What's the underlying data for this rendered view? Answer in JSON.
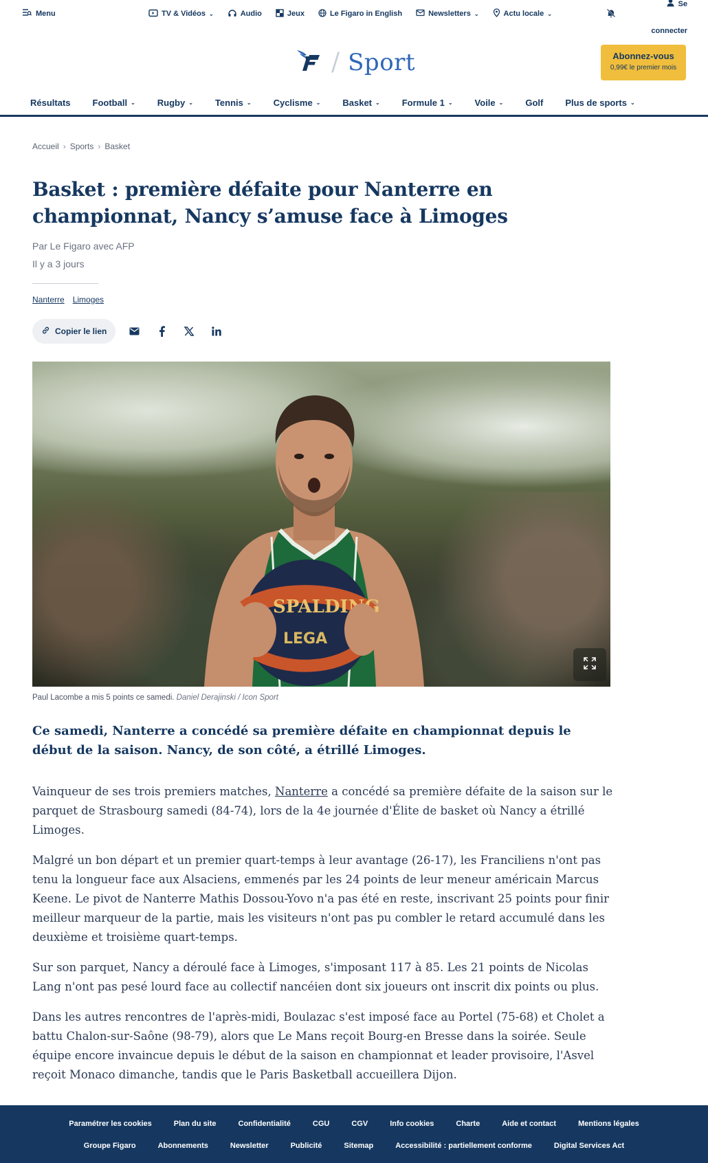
{
  "header": {
    "menu_label": "Menu",
    "top_links": [
      {
        "label": "TV & Vidéos",
        "icon": "tv-icon",
        "dropdown": true
      },
      {
        "label": "Audio",
        "icon": "headphones-icon",
        "dropdown": false
      },
      {
        "label": "Jeux",
        "icon": "grid-icon",
        "dropdown": false
      },
      {
        "label": "Le Figaro in English",
        "icon": "globe-icon",
        "dropdown": false
      },
      {
        "label": "Newsletters",
        "icon": "mail-icon",
        "dropdown": true
      },
      {
        "label": "Actu locale",
        "icon": "pin-icon",
        "dropdown": true
      }
    ],
    "login_line1": "Se",
    "login_line2": "connecter",
    "section_title": "Sport",
    "subscribe_title": "Abonnez-vous",
    "subscribe_offer": "0,99€ le premier mois"
  },
  "sport_nav": [
    {
      "label": "Résultats",
      "dropdown": false
    },
    {
      "label": "Football",
      "dropdown": true
    },
    {
      "label": "Rugby",
      "dropdown": true
    },
    {
      "label": "Tennis",
      "dropdown": true
    },
    {
      "label": "Cyclisme",
      "dropdown": true
    },
    {
      "label": "Basket",
      "dropdown": true
    },
    {
      "label": "Formule 1",
      "dropdown": true
    },
    {
      "label": "Voile",
      "dropdown": true
    },
    {
      "label": "Golf",
      "dropdown": false
    },
    {
      "label": "Plus de sports",
      "dropdown": true
    }
  ],
  "breadcrumb": [
    "Accueil",
    "Sports",
    "Basket"
  ],
  "article": {
    "title": "Basket : première défaite pour Nanterre en championnat, Nancy s’amuse face à Limoges",
    "author": "Par Le Figaro avec AFP",
    "date": "Il y a 3 jours",
    "tags": [
      "Nanterre",
      "Limoges"
    ],
    "copy_link_label": "Copier le lien",
    "caption_text": "Paul Lacombe a mis 5 points ce samedi.",
    "caption_credit": "Daniel Derajinski / Icon Sport",
    "lead": "Ce samedi, Nanterre a concédé sa première défaite en championnat depuis le début de la saison. Nancy, de son côté, a étrillé Limoges.",
    "p1_before": "Vainqueur de ses trois premiers matches, ",
    "p1_link": "Nanterre",
    "p1_after": " a concédé sa première défaite de la saison sur le parquet de Strasbourg samedi (84-74), lors de la 4e journée d'Élite de basket où Nancy a étrillé Limoges.",
    "p2": "Malgré un bon départ et un premier quart-temps à leur avantage (26-17), les Franciliens n'ont pas tenu la longueur face aux Alsaciens, emmenés par les 24 points de leur meneur américain Marcus Keene. Le pivot de Nanterre Mathis Dossou-Yovo n'a pas été en reste, inscrivant 25 points pour finir meilleur marqueur de la partie, mais les visiteurs n'ont pas pu combler le retard accumulé dans les deuxième et troisième quart-temps.",
    "p3": "Sur son parquet, Nancy a déroulé face à Limoges, s'imposant 117 à 85. Les 21 points de Nicolas Lang n'ont pas pesé lourd face au collectif nancéien dont six joueurs ont inscrit dix points ou plus.",
    "p4": "Dans les autres rencontres de l'après-midi, Boulazac s'est imposé face au Portel (75-68) et Cholet a battu Chalon-sur-Saône (98-79), alors que Le Mans reçoit Bourg-en Bresse dans la soirée. Seule équipe encore invaincue depuis le début de la saison en championnat et leader provisoire, l'Asvel reçoit Monaco dimanche, tandis que le Paris Basketball accueillera Dijon."
  },
  "footer": {
    "row1": [
      "Paramétrer les cookies",
      "Plan du site",
      "Confidentialité",
      "CGU",
      "CGV",
      "Info cookies",
      "Charte",
      "Aide et contact",
      "Mentions légales"
    ],
    "row2": [
      "Groupe Figaro",
      "Abonnements",
      "Newsletter",
      "Publicité",
      "Sitemap",
      "Accessibilité : partiellement conforme",
      "Digital Services Act"
    ]
  },
  "colors": {
    "navy": "#163860",
    "section_blue": "#2f66b8",
    "subscribe_yellow": "#f0be3c",
    "footer_bg": "#163860"
  }
}
